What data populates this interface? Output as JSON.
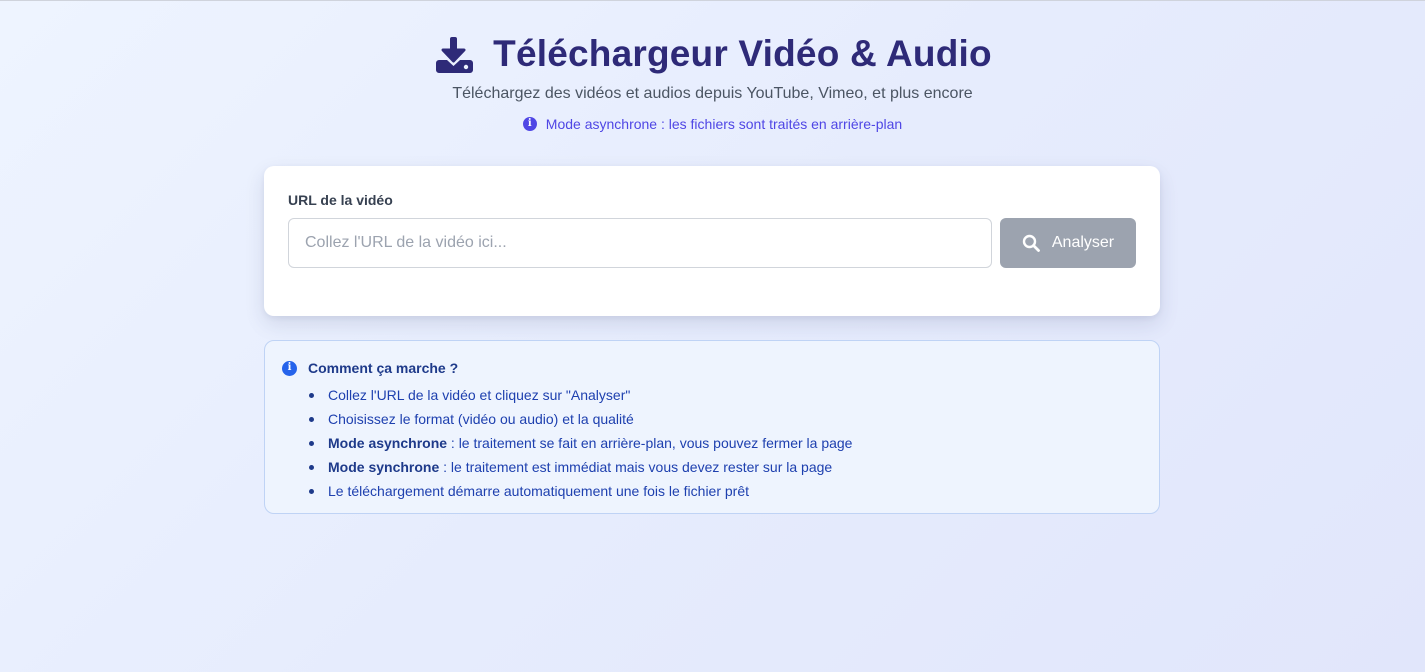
{
  "header": {
    "title": "Téléchargeur Vidéo & Audio",
    "title_icon": "download-icon",
    "subtitle": "Téléchargez des vidéos et audios depuis YouTube, Vimeo, et plus encore",
    "mode_note": "Mode asynchrone : les fichiers sont traités en arrière-plan",
    "mode_note_icon": "info-icon"
  },
  "form": {
    "url_label": "URL de la vidéo",
    "url_value": "",
    "url_placeholder": "Collez l'URL de la vidéo ici...",
    "analyze_label": "Analyser",
    "analyze_icon": "search-icon"
  },
  "help": {
    "title": "Comment ça marche ?",
    "icon": "info-icon",
    "items": [
      {
        "bold": "",
        "text": "Collez l'URL de la vidéo et cliquez sur \"Analyser\""
      },
      {
        "bold": "",
        "text": "Choisissez le format (vidéo ou audio) et la qualité"
      },
      {
        "bold": "Mode asynchrone",
        "text": " : le traitement se fait en arrière-plan, vous pouvez fermer la page"
      },
      {
        "bold": "Mode synchrone",
        "text": " : le traitement est immédiat mais vous devez rester sur la page"
      },
      {
        "bold": "",
        "text": "Le téléchargement démarre automatiquement une fois le fichier prêt"
      }
    ]
  },
  "colors": {
    "title": "#2e2a78",
    "accent": "#4f46e5",
    "button_disabled": "#9ca3af",
    "info_box_bg": "#eef4fe",
    "info_text": "#1e40af"
  }
}
